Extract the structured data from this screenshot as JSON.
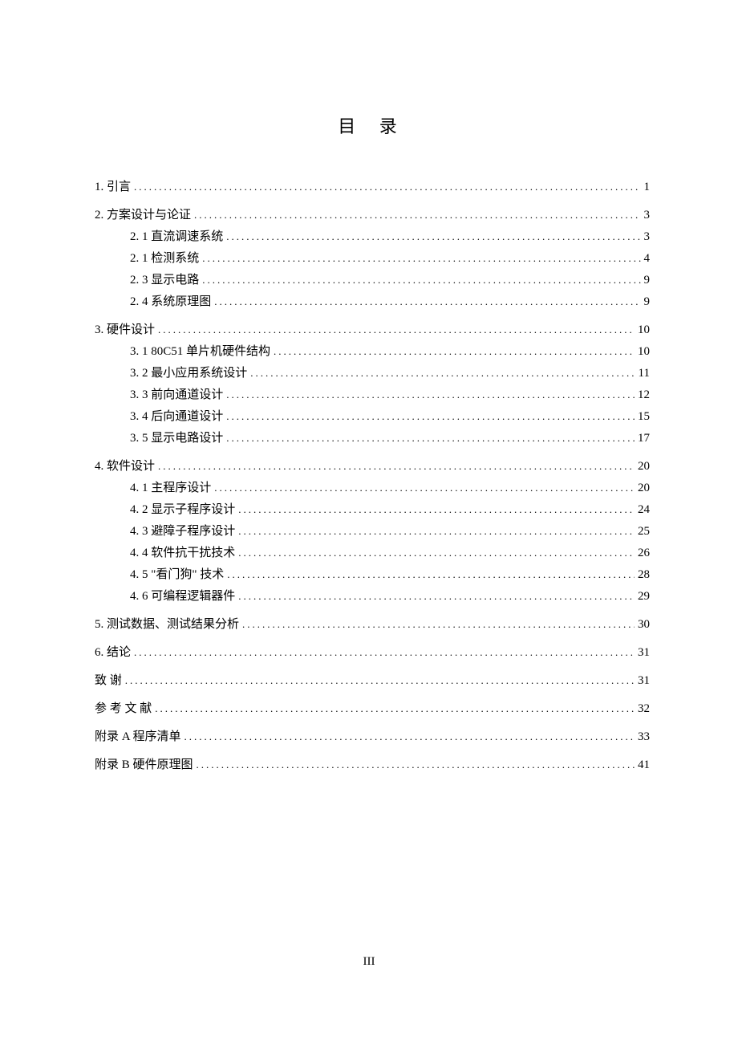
{
  "title": "目  录",
  "page_number": "III",
  "toc": [
    {
      "level": 1,
      "label": "1. 引言",
      "page": "1",
      "gap": false
    },
    {
      "level": 1,
      "label": "2. 方案设计与论证",
      "page": "3",
      "gap": true
    },
    {
      "level": 2,
      "label": "2. 1  直流调速系统",
      "page": "3",
      "gap": false
    },
    {
      "level": 2,
      "label": "2. 1  检测系统",
      "page": "4",
      "gap": false
    },
    {
      "level": 2,
      "label": "2. 3 显示电路",
      "page": "9",
      "gap": false
    },
    {
      "level": 2,
      "label": "2. 4 系统原理图",
      "page": "9",
      "gap": false
    },
    {
      "level": 1,
      "label": "3. 硬件设计",
      "page": "10",
      "gap": true
    },
    {
      "level": 2,
      "label": "3. 1  80C51 单片机硬件结构",
      "page": "10",
      "gap": false
    },
    {
      "level": 2,
      "label": "3. 2  最小应用系统设计",
      "page": "11",
      "gap": false
    },
    {
      "level": 2,
      "label": "3. 3 前向通道设计",
      "page": "12",
      "gap": false
    },
    {
      "level": 2,
      "label": "3. 4 后向通道设计",
      "page": "15",
      "gap": false
    },
    {
      "level": 2,
      "label": "3. 5 显示电路设计",
      "page": "17",
      "gap": false
    },
    {
      "level": 1,
      "label": "4. 软件设计",
      "page": "20",
      "gap": true
    },
    {
      "level": 2,
      "label": "4. 1 主程序设计",
      "page": "20",
      "gap": false
    },
    {
      "level": 2,
      "label": "4. 2 显示子程序设计",
      "page": "24",
      "gap": false
    },
    {
      "level": 2,
      "label": "4. 3 避障子程序设计",
      "page": "25",
      "gap": false
    },
    {
      "level": 2,
      "label": "4. 4 软件抗干扰技术",
      "page": "26",
      "gap": false
    },
    {
      "level": 2,
      "label": "4. 5 \"看门狗\" 技术",
      "page": "28",
      "gap": false
    },
    {
      "level": 2,
      "label": "4. 6 可编程逻辑器件",
      "page": "29",
      "gap": false
    },
    {
      "level": 1,
      "label": "5. 测试数据、测试结果分析",
      "page": "30",
      "gap": true
    },
    {
      "level": 1,
      "label": "6. 结论",
      "page": "31",
      "gap": true
    },
    {
      "level": 1,
      "label": "致    谢",
      "page": "31",
      "gap": true
    },
    {
      "level": 1,
      "label": "参 考 文 献",
      "page": "32",
      "gap": true
    },
    {
      "level": 1,
      "label": "附录 A  程序清单",
      "page": "33",
      "gap": true
    },
    {
      "level": 1,
      "label": "附录 B  硬件原理图",
      "page": "41",
      "gap": true
    }
  ]
}
